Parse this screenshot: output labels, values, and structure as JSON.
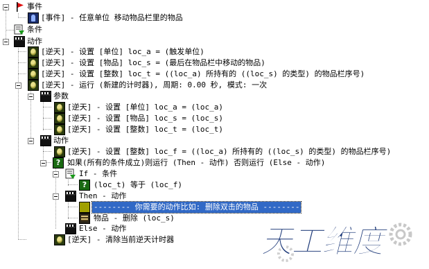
{
  "tree": {
    "events_label": "事件",
    "event_1": "[事件] - 任意单位 移动物品栏里的物品",
    "conditions_label": "条件",
    "actions_label": "动作",
    "action_1": "[逆天] - 设置 [单位] loc_a = (触发单位)",
    "action_2": "[逆天] - 设置 [物品] loc_s = (最后在物品栏中移动的物品)",
    "action_3": "[逆天] - 设置 [整数] loc_t = ((loc_a) 所持有的 ((loc_s) 的类型) 的物品栏序号)",
    "action_4": "[逆天] - 运行 (新建的计时器), 周期: 0.00 秒, 模式: 一次",
    "params_label": "参数",
    "param_1": "[逆天] - 设置 [单位] loc_a = (loc_a)",
    "param_2": "[逆天] - 设置 [物品] loc_s = (loc_s)",
    "param_3": "[逆天] - 设置 [整数] loc_t = (loc_t)",
    "inner_actions_label": "动作",
    "inner_action_1": "[逆天] - 设置 [整数] loc_f = ((loc_a) 所持有的 ((loc_s) 的类型) 的物品栏序号)",
    "if_block": "如果(所有的条件成立)则运行 (Then - 动作) 否则运行 (Else - 动作)",
    "if_label": "If - 条件",
    "if_cond": "(loc_t) 等于 (loc_f)",
    "then_label": "Then - 动作",
    "then_comment": "-------- 你需要的动作比如: 删除双击的物品 --------",
    "then_action": "物品 - 删除 (loc_s)",
    "else_label": "Else - 动作",
    "final_action": "[逆天] - 清除当前逆天计时器"
  },
  "icons": {
    "event": "red-flag-icon",
    "conditions": "condition-icon",
    "actions": "clapperboard-icon",
    "action": "action-icon",
    "unit_event": "unit-icon",
    "if": "question-icon",
    "comment": "hole-icon",
    "item": "item-icon"
  },
  "colors": {
    "selection": "#3169c6",
    "line": "#9a9a9a"
  },
  "watermark": {
    "text": "天工维度"
  }
}
